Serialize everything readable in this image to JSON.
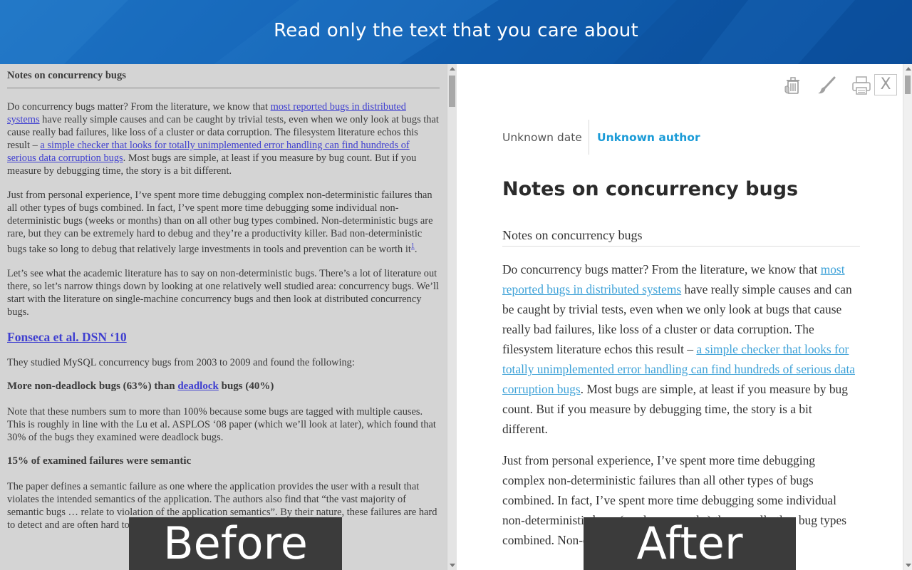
{
  "banner": {
    "title": "Read only the text that you care about"
  },
  "before": {
    "heading": "Notes on concurrency bugs",
    "p1": {
      "t1": "Do concurrency bugs matter? From the literature, we know that ",
      "link1": "most reported bugs in distributed systems",
      "t2": " have really simple causes and can be caught by trivial tests, even when we only look at bugs that cause really bad failures, like loss of a cluster or data corruption. The filesystem literature echos this result – ",
      "link2": "a simple checker that looks for totally unimplemented error handling can find hundreds of serious data corruption bugs",
      "t3": ". Most bugs are simple, at least if you measure by bug count. But if you measure by debugging time, the story is a bit different."
    },
    "p2": {
      "text": "Just from personal experience, I’ve spent more time debugging complex non-deterministic failures than all other types of bugs combined. In fact, I’ve spent more time debugging some individual non-deterministic bugs (weeks or months) than on all other bug types combined. Non-deterministic bugs are rare, but they can be extremely hard to debug and they’re a productivity killer. Bad non-deterministic bugs take so long to debug that relatively large investments in tools and prevention can be worth it",
      "footnote": "1",
      "end": "."
    },
    "p3": "Let’s see what the academic literature has to say on non-deterministic bugs. There’s a lot of literature out there, so let’s narrow things down by looking at one relatively well studied area: concurrency bugs. We’ll start with the literature on single-machine concurrency bugs and then look at distributed concurrency bugs.",
    "h2": "Fonseca et al. DSN ‘10",
    "p4": "They studied MySQL concurrency bugs from 2003 to 2009 and found the following:",
    "b1": {
      "t1": "More non-deadlock bugs (63%) than ",
      "link": "deadlock",
      "t2": " bugs (40%)"
    },
    "p5": "Note that these numbers sum to more than 100% because some bugs are tagged with multiple causes. This is roughly in line with the Lu et al. ASPLOS ‘08 paper (which we’ll look at later), which found that 30% of the bugs they examined were deadlock bugs.",
    "b2": "15% of examined failures were semantic",
    "p6": "The paper defines a semantic failure as one where the application provides the user with a result that violates the intended semantics of the application. The authors also find that “the vast majority of semantic bugs … relate to violation of the application semantics”. By their nature, these failures are hard to detect and are often hard to reason to reset a"
  },
  "after": {
    "meta": {
      "date": "Unknown date",
      "author": "Unknown author"
    },
    "title": "Notes on concurrency bugs",
    "subtitle": "Notes on concurrency bugs",
    "p1": {
      "t1": "Do concurrency bugs matter? From the literature, we know that ",
      "link1": "most reported bugs in distributed systems",
      "t2": " have really simple causes and can be caught by trivial tests, even when we only look at bugs that cause really bad failures, like loss of a cluster or data corruption. The filesystem literature echos this result – ",
      "link2": "a simple checker that looks for totally unimplemented error handling can find hundreds of serious data corruption bugs",
      "t3": ". Most bugs are simple, at least if you measure by bug count. But if you measure by debugging time, the story is a bit different."
    },
    "p2": "Just from personal experience, I’ve spent more time debugging complex non-deterministic failures than all other types of bugs combined. In fact, I’ve spent more time debugging some individual non-deterministic bugs (weeks or months) than on all other bug types combined. Non-deterministic bugs are rare,"
  },
  "toolbar": {
    "icons": [
      "trash-icon",
      "brush-icon",
      "print-icon",
      "close-icon"
    ],
    "close_label": "X"
  },
  "labels": {
    "before": "Before",
    "after": "After"
  }
}
